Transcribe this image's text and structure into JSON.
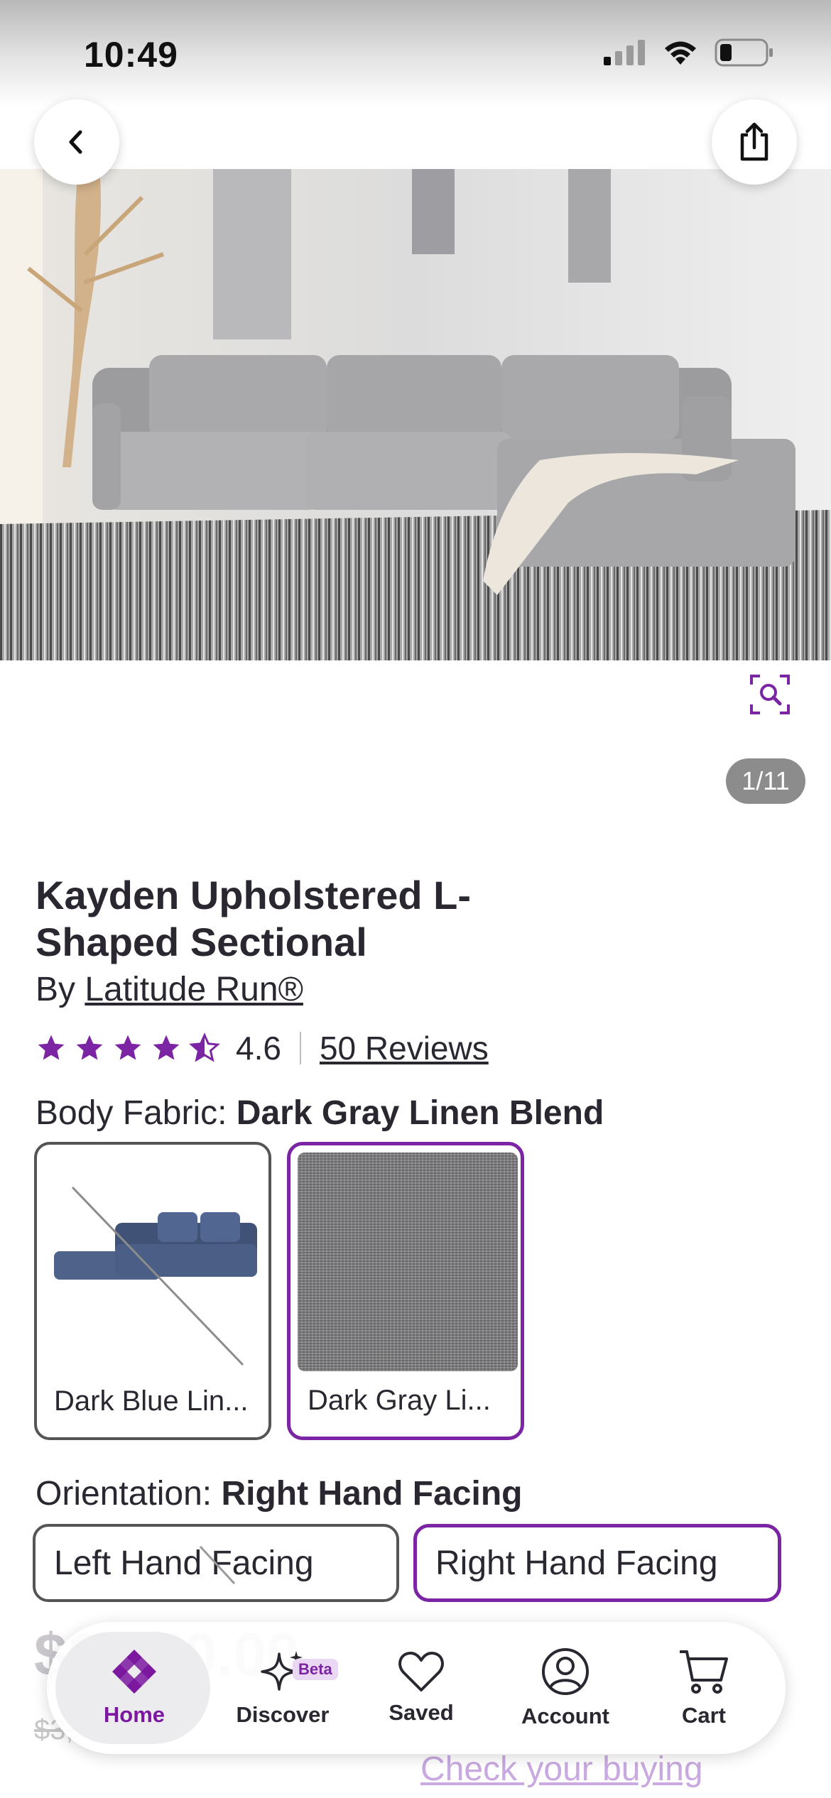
{
  "status_bar": {
    "time": "10:49"
  },
  "gallery": {
    "counter": "1/11"
  },
  "product": {
    "title": "Kayden Upholstered L-Shaped Sectional",
    "by_prefix": "By",
    "brand": "Latitude Run®",
    "rating": "4.6",
    "rating_stars": 4.5,
    "reviews": "50 Reviews"
  },
  "body_fabric": {
    "label": "Body Fabric:",
    "selected": "Dark Gray Linen Blend",
    "options": [
      {
        "label": "Dark Blue Lin...",
        "available": false
      },
      {
        "label": "Dark Gray Li...",
        "available": true,
        "selected": true
      }
    ]
  },
  "orientation": {
    "label": "Orientation:",
    "selected": "Right Hand Facing",
    "options": [
      {
        "label": "Left Hand Facing",
        "available": false
      },
      {
        "label": "Right Hand Facing",
        "available": true,
        "selected": true
      }
    ]
  },
  "pricing_partial": {
    "price": "$1,450.00",
    "old_price": "$3,",
    "financing_link": "Check your buying"
  },
  "bottom_nav": {
    "items": [
      {
        "label": "Home",
        "active": true
      },
      {
        "label": "Discover",
        "badge": "Beta"
      },
      {
        "label": "Saved"
      },
      {
        "label": "Account"
      },
      {
        "label": "Cart"
      }
    ]
  },
  "colors": {
    "accent": "#7b25a4",
    "text": "#2b2730"
  }
}
